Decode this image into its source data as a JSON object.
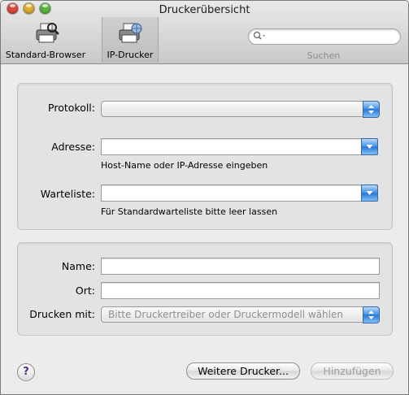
{
  "window": {
    "title": "Druckerübersicht"
  },
  "traffic_lights": {
    "close_color": "#e0483e",
    "minimize_color": "#e0b030",
    "zoom_color": "#5cb841"
  },
  "toolbar": {
    "items": [
      {
        "label": "Standard-Browser",
        "icon": "printer-icon",
        "selected": false
      },
      {
        "label": "IP-Drucker",
        "icon": "network-printer-icon",
        "selected": true
      }
    ],
    "search": {
      "placeholder": "",
      "label": "Suchen"
    }
  },
  "connection": {
    "protocol": {
      "label": "Protokoll:",
      "value": ""
    },
    "address": {
      "label": "Adresse:",
      "value": "",
      "hint": "Host-Name oder IP-Adresse eingeben"
    },
    "queue": {
      "label": "Warteliste:",
      "value": "",
      "hint": "Für Standardwarteliste bitte leer lassen"
    }
  },
  "details": {
    "name": {
      "label": "Name:",
      "value": ""
    },
    "location": {
      "label": "Ort:",
      "value": ""
    },
    "print_using": {
      "label": "Drucken mit:",
      "value": "Bitte Druckertreiber oder Druckermodell wählen"
    }
  },
  "buttons": {
    "help": "?",
    "more_printers": "Weitere Drucker...",
    "add": "Hinzufügen"
  }
}
